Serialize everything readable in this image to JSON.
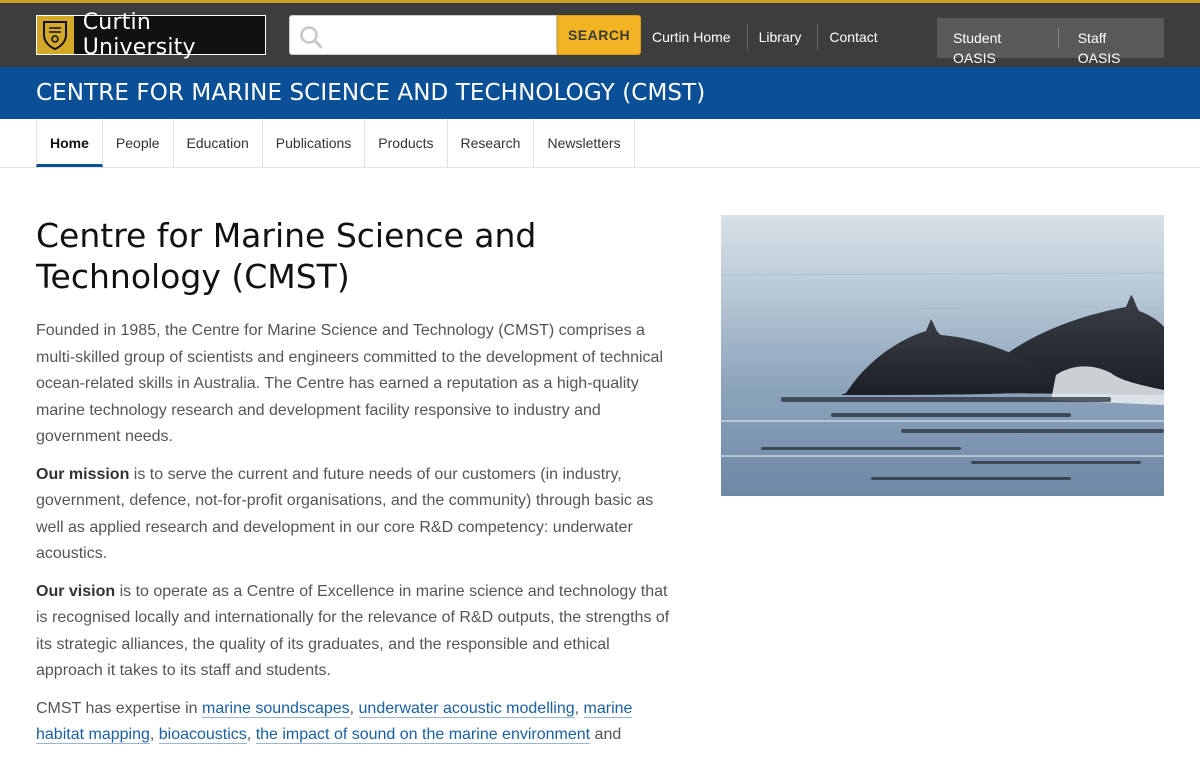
{
  "header": {
    "logo_text": "Curtin University",
    "search_placeholder": "",
    "search_button": "SEARCH",
    "links": [
      "Curtin Home",
      "Library",
      "Contact"
    ],
    "oasis": [
      "Student OASIS",
      "Staff OASIS"
    ]
  },
  "site_title": "CENTRE FOR MARINE SCIENCE AND TECHNOLOGY (CMST)",
  "nav": {
    "tabs": [
      "Home",
      "People",
      "Education",
      "Publications",
      "Products",
      "Research",
      "Newsletters"
    ],
    "active": "Home"
  },
  "content": {
    "heading": "Centre for Marine Science and Technology (CMST)",
    "intro": "Founded in 1985, the Centre for Marine Science and Technology (CMST) comprises a multi-skilled group of scientists and engineers committed to the development of technical ocean-related skills in Australia. The Centre has earned a reputation as a high-quality marine technology research and development facility responsive to industry and government needs.",
    "mission_label": "Our mission",
    "mission_text": " is to serve the current and future needs of our customers (in industry, government, defence, not-for-profit organisations, and the community) through basic as well as applied research and development in our core R&D competency: underwater acoustics.",
    "vision_label": "Our vision",
    "vision_text": " is to operate as a Centre of Excellence in marine science and technology that is recognised locally and internationally for the relevance of R&D outputs, the strengths of its strategic alliances, the quality of its graduates, and the responsible and ethical approach it takes to its staff and students.",
    "expertise_prefix": "CMST has expertise in ",
    "expertise_links": [
      "marine soundscapes",
      "underwater acoustic modelling",
      "marine habitat mapping",
      "bioacoustics",
      "the impact of sound on the marine environment"
    ],
    "expertise_suffix": " and"
  },
  "colors": {
    "topbar": "#3d3d3d",
    "accent_gold": "#f2b422",
    "title_blue": "#0b4f96",
    "link_blue": "#1b5fa3"
  }
}
